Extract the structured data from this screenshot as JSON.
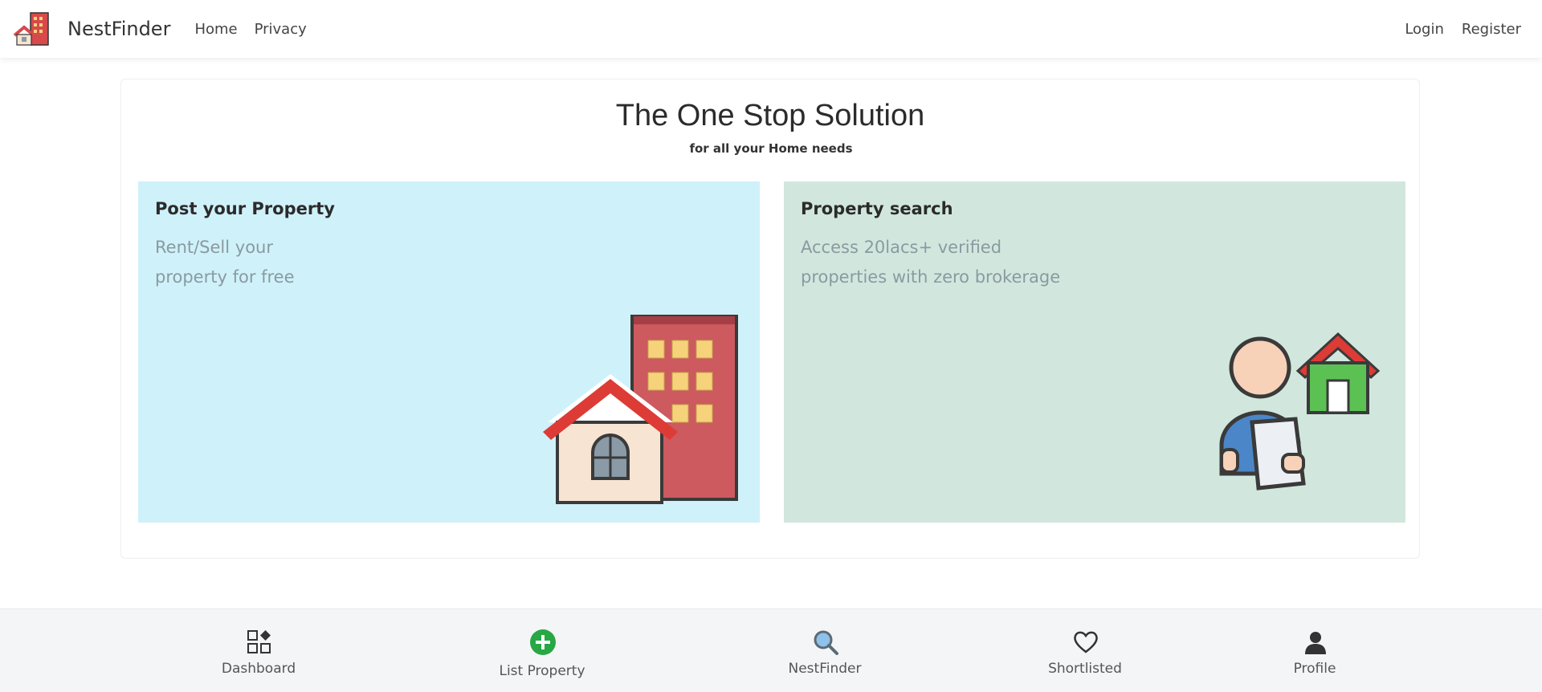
{
  "brand": {
    "name": "NestFinder",
    "logo_icon": "building-house-logo-icon"
  },
  "nav": {
    "left_links": [
      {
        "label": "Home"
      },
      {
        "label": "Privacy"
      }
    ],
    "right_links": [
      {
        "label": "Login"
      },
      {
        "label": "Register"
      }
    ]
  },
  "hero": {
    "title": "The One Stop Solution",
    "subtitle": "for all your Home needs",
    "tiles": [
      {
        "title": "Post your Property",
        "desc_lines": [
          "Rent/Sell your",
          "property for free"
        ],
        "icon": "house-building-illustration",
        "bg_color": "#cff1fa"
      },
      {
        "title": "Property search",
        "desc_lines": [
          "Access 20lacs+ verified",
          "properties with zero brokerage"
        ],
        "icon": "person-house-illustration",
        "bg_color": "#d1e7de"
      }
    ]
  },
  "bottom_nav": {
    "items": [
      {
        "label": "Dashboard",
        "icon": "dashboard-icon"
      },
      {
        "label": "List Property",
        "icon": "plus-circle-icon",
        "accent": "#28a745"
      },
      {
        "label": "NestFinder",
        "icon": "search-icon"
      },
      {
        "label": "Shortlisted",
        "icon": "heart-icon"
      },
      {
        "label": "Profile",
        "icon": "user-icon"
      }
    ]
  },
  "colors": {
    "navbar_bg": "#ffffff",
    "footer_bg": "#f4f5f7",
    "accent_green": "#28a745",
    "muted_text": "#8a9aa0"
  }
}
